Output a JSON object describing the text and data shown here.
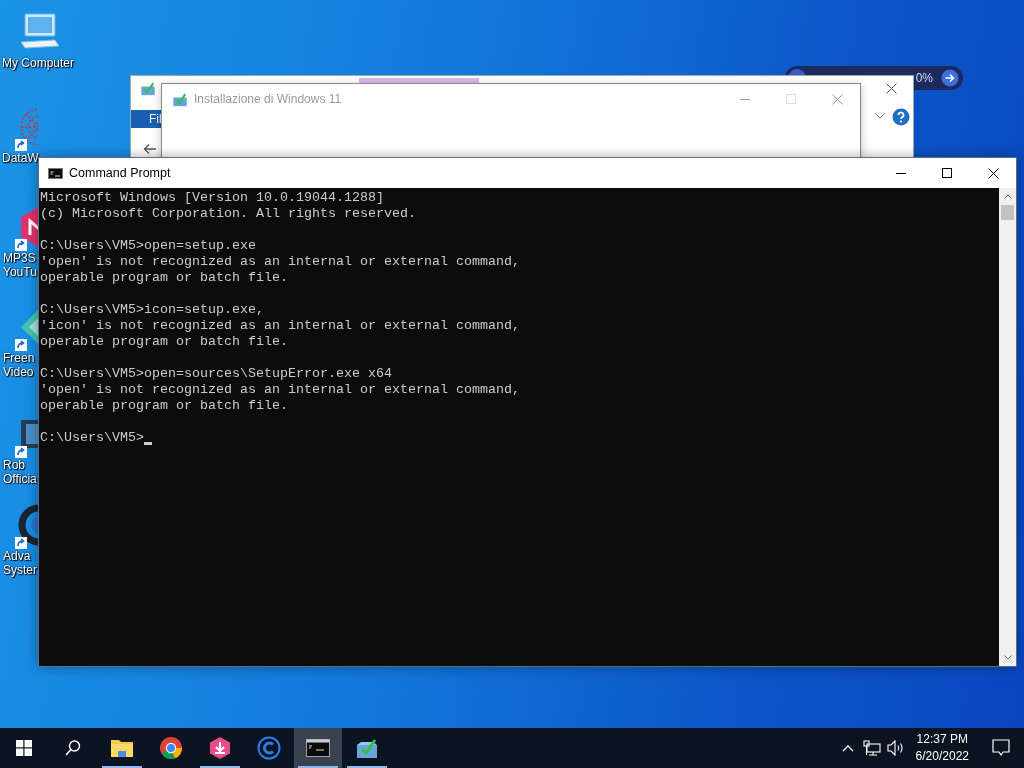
{
  "desktop_icons": [
    {
      "kind": "computer",
      "label": [
        "My Computer"
      ],
      "shortcut": false
    },
    {
      "kind": "snowflake",
      "label": [
        "DataW"
      ],
      "shortcut": true
    },
    {
      "kind": "hexagon",
      "label": [
        "MP3S",
        "YouTu"
      ],
      "shortcut": true
    },
    {
      "kind": "diamond",
      "label": [
        "Freen",
        "Video"
      ],
      "shortcut": true
    },
    {
      "kind": "film",
      "label": [
        "Rob",
        "Officia"
      ],
      "shortcut": true
    },
    {
      "kind": "ring",
      "label": [
        "Adva",
        "Syster"
      ],
      "shortcut": true
    }
  ],
  "progress_widget": {
    "reading": "0%"
  },
  "explorer_window": {
    "ribbon_tab": "Fil"
  },
  "setup_window": {
    "title": "Installazione di Windows 11"
  },
  "command_prompt": {
    "title": "Command Prompt",
    "blocks": [
      [
        "Microsoft Windows [Version 10.0.19044.1288]",
        "(c) Microsoft Corporation. All rights reserved."
      ],
      [
        "C:\\Users\\VM5>open=setup.exe",
        "'open' is not recognized as an internal or external command,",
        "operable program or batch file."
      ],
      [
        "C:\\Users\\VM5>icon=setup.exe,",
        "'icon' is not recognized as an internal or external command,",
        "operable program or batch file."
      ],
      [
        "C:\\Users\\VM5>open=sources\\SetupError.exe x64",
        "'open' is not recognized as an internal or external command,",
        "operable program or batch file."
      ],
      [
        "C:\\Users\\VM5>"
      ]
    ],
    "cursor": true
  },
  "taskbar": {
    "items": [
      {
        "kind": "start",
        "running": false,
        "selected": false
      },
      {
        "kind": "search",
        "running": false,
        "selected": false
      },
      {
        "kind": "folder",
        "running": true,
        "selected": false
      },
      {
        "kind": "browser",
        "running": false,
        "selected": false
      },
      {
        "kind": "downloader",
        "running": true,
        "selected": false
      },
      {
        "kind": "cleaner",
        "running": false,
        "selected": false
      },
      {
        "kind": "terminal",
        "running": true,
        "selected": true
      },
      {
        "kind": "installer",
        "running": true,
        "selected": false
      }
    ],
    "clock": {
      "time": "12:37 PM",
      "date": "6/20/2022"
    }
  }
}
